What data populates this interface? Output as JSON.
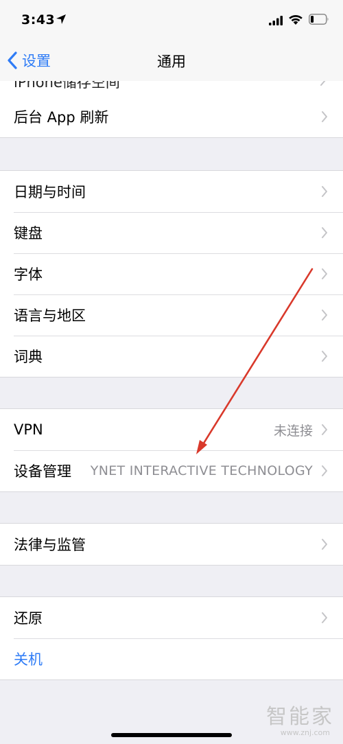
{
  "status": {
    "time": "3:43",
    "location_icon": "location-arrow-icon",
    "signal_icon": "cellular-signal-icon",
    "wifi_icon": "wifi-icon",
    "battery_icon": "battery-icon",
    "battery_level": 0.2
  },
  "nav": {
    "back_label": "设置",
    "title": "通用"
  },
  "clipped_item": {
    "label": "iPhone储存空间"
  },
  "groups": [
    {
      "rows": [
        {
          "label": "后台 App 刷新",
          "value": ""
        }
      ]
    },
    {
      "rows": [
        {
          "label": "日期与时间",
          "value": ""
        },
        {
          "label": "键盘",
          "value": ""
        },
        {
          "label": "字体",
          "value": ""
        },
        {
          "label": "语言与地区",
          "value": ""
        },
        {
          "label": "词典",
          "value": ""
        }
      ]
    },
    {
      "rows": [
        {
          "label": "VPN",
          "value": "未连接"
        },
        {
          "label": "设备管理",
          "value": "YNET INTERACTIVE TECHNOLOGY"
        }
      ]
    },
    {
      "rows": [
        {
          "label": "法律与监管",
          "value": ""
        }
      ]
    },
    {
      "rows": [
        {
          "label": "还原",
          "value": ""
        },
        {
          "label": "关机",
          "value": ""
        }
      ]
    }
  ],
  "watermark": {
    "brand": "智能家",
    "url": "www.znj.com"
  },
  "colors": {
    "accent": "#2f7cf6",
    "background": "#efeff4",
    "secondary_text": "#8e8e93",
    "annotation_arrow": "#d9392b"
  }
}
